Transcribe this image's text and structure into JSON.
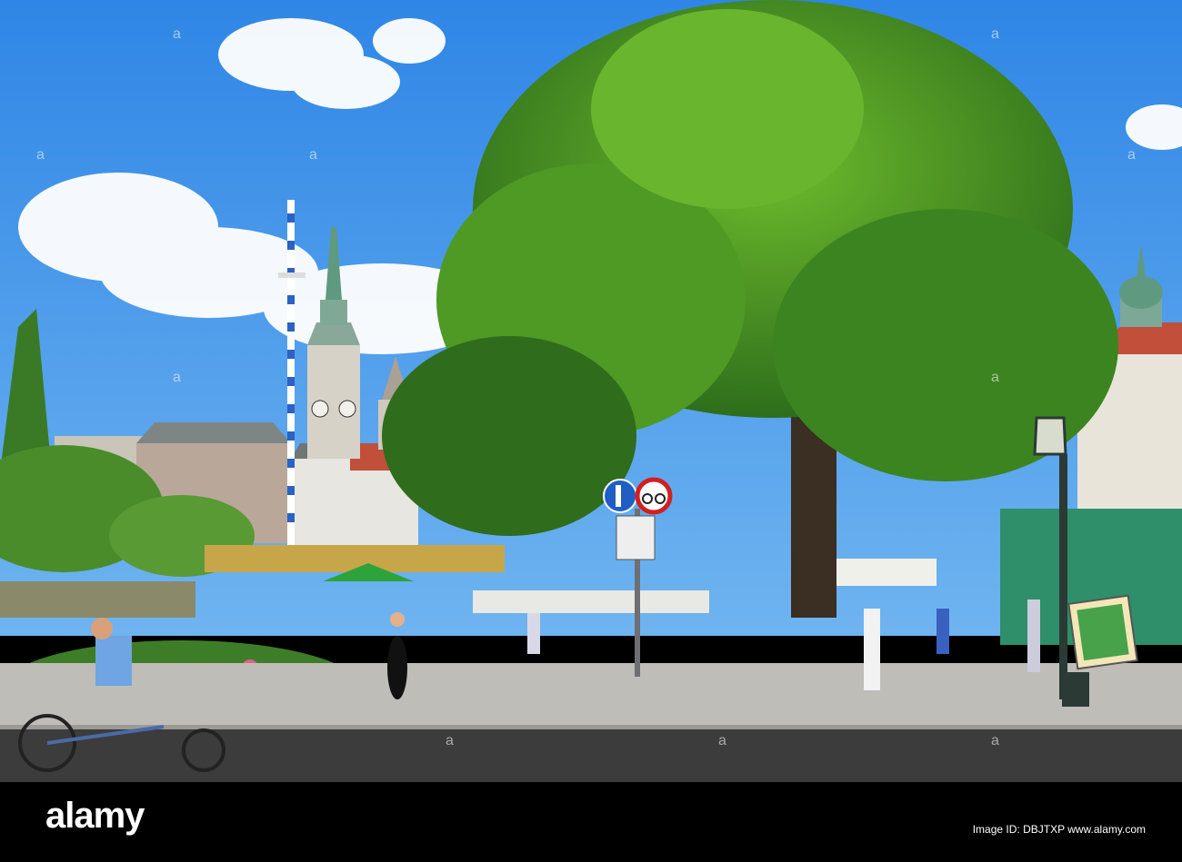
{
  "photo": {
    "subject": "Munich market square with tree, maypole and towers"
  },
  "signs": {
    "pedestrian_bike": "pedestrian-bicycle-sign",
    "no_bikes": "no-bicycles-sign"
  },
  "footer": {
    "logo": "alamy",
    "caption": "Image ID: DBJTXP www.alamy.com"
  },
  "colors": {
    "sky": "#3d94e8",
    "foliage": "#3f8a22",
    "tower": "#d6d2c8",
    "road": "#3c3c3c",
    "pavement": "#bfbdb8"
  }
}
